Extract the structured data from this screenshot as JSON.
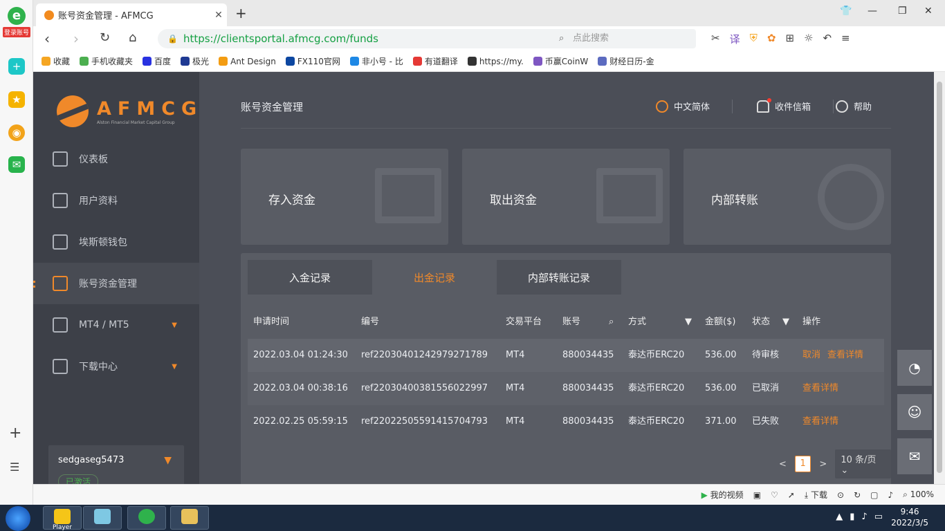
{
  "appstrip": {
    "badge": "登录账号",
    "logo_letter": "e"
  },
  "browser": {
    "tab_title": "账号资金管理 - AFMCG",
    "url": "https://clientsportal.afmcg.com/funds",
    "search_placeholder": "点此搜索",
    "translate_label": "译",
    "bookmarks": [
      {
        "label": "收藏",
        "color": "#f5a623"
      },
      {
        "label": "手机收藏夹",
        "color": "#4caf50"
      },
      {
        "label": "百度",
        "color": "#2932e1"
      },
      {
        "label": "极光",
        "color": "#1f3a93"
      },
      {
        "label": "Ant Design",
        "color": "#f39c12"
      },
      {
        "label": "FX110官网",
        "color": "#0d47a1"
      },
      {
        "label": "非小号 - 比",
        "color": "#1e88e5"
      },
      {
        "label": "有道翻译",
        "color": "#e53935"
      },
      {
        "label": "https://my.",
        "color": "#333333"
      },
      {
        "label": "币赢CoinW",
        "color": "#7e57c2"
      },
      {
        "label": "财经日历-金",
        "color": "#5c6bc0"
      }
    ]
  },
  "brand": {
    "name": "AFMCG",
    "tagline": "Alston Financial Market Capital Group"
  },
  "sidebar": {
    "items": [
      {
        "label": "仪表板"
      },
      {
        "label": "用户资料"
      },
      {
        "label": "埃斯顿钱包"
      },
      {
        "label": "账号资金管理"
      },
      {
        "label": "MT4 / MT5"
      },
      {
        "label": "下载中心"
      }
    ],
    "user": {
      "name": "sedgaseg5473",
      "status": "已激活"
    }
  },
  "header": {
    "title": "账号资金管理",
    "language": "中文简体",
    "inbox": "收件信箱",
    "help": "帮助"
  },
  "cards": [
    {
      "label": "存入资金"
    },
    {
      "label": "取出资金"
    },
    {
      "label": "内部转账"
    }
  ],
  "tabs": [
    {
      "label": "入金记录"
    },
    {
      "label": "出金记录"
    },
    {
      "label": "内部转账记录"
    }
  ],
  "table": {
    "headers": [
      "申请时间",
      "编号",
      "交易平台",
      "账号",
      "方式",
      "金额($)",
      "状态",
      "操作"
    ],
    "rows": [
      {
        "time": "2022.03.04 01:24:30",
        "id": "ref22030401242979271789",
        "platform": "MT4",
        "account": "880034435",
        "method": "泰达币ERC20",
        "amount": "536.00",
        "status": "待审核",
        "actions": [
          "取消",
          "查看详情"
        ]
      },
      {
        "time": "2022.03.04 00:38:16",
        "id": "ref22030400381556022997",
        "platform": "MT4",
        "account": "880034435",
        "method": "泰达币ERC20",
        "amount": "536.00",
        "status": "已取消",
        "actions": [
          "查看详情"
        ]
      },
      {
        "time": "2022.02.25 05:59:15",
        "id": "ref22022505591415704793",
        "platform": "MT4",
        "account": "880034435",
        "method": "泰达币ERC20",
        "amount": "371.00",
        "status": "已失败",
        "actions": [
          "查看详情"
        ]
      }
    ]
  },
  "pagination": {
    "prev": "<",
    "current": "1",
    "next": ">",
    "page_size": "10 条/页"
  },
  "statusbar": {
    "video": "我的视频",
    "download": "下载",
    "zoom": "100%"
  },
  "taskbar": {
    "player_label": "Player",
    "time": "9:46",
    "date": "2022/3/5"
  }
}
